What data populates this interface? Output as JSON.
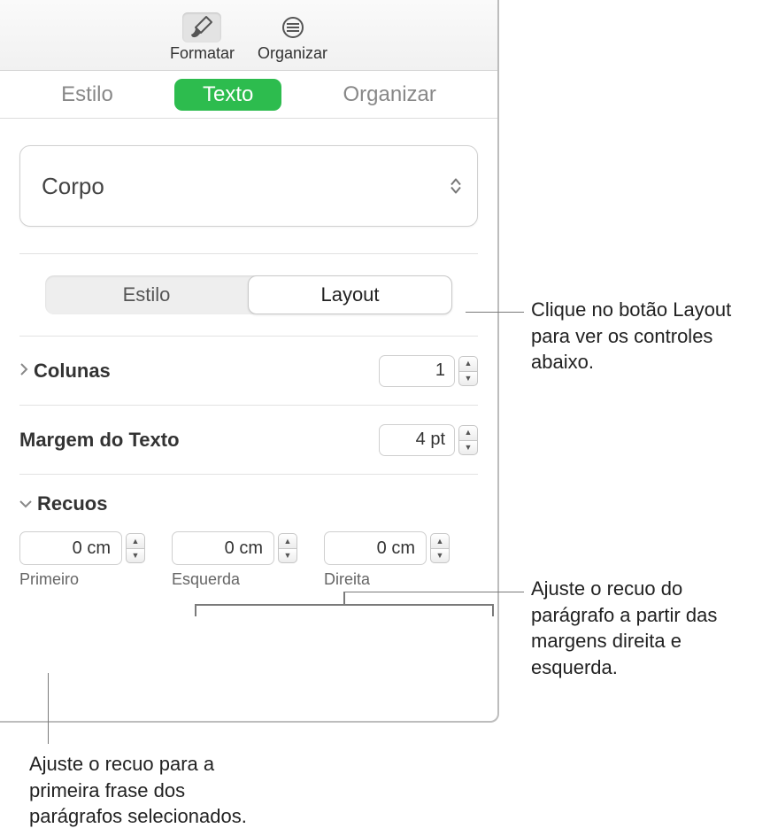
{
  "toolbar": {
    "format": "Formatar",
    "organize": "Organizar"
  },
  "subtabs": {
    "style": "Estilo",
    "text": "Texto",
    "organize": "Organizar"
  },
  "paragraphStyle": "Corpo",
  "segmented": {
    "style": "Estilo",
    "layout": "Layout"
  },
  "columns": {
    "label": "Colunas",
    "value": "1"
  },
  "textMargin": {
    "label": "Margem do Texto",
    "value": "4 pt"
  },
  "indents": {
    "label": "Recuos",
    "first": {
      "value": "0 cm",
      "label": "Primeiro"
    },
    "left": {
      "value": "0 cm",
      "label": "Esquerda"
    },
    "right": {
      "value": "0 cm",
      "label": "Direita"
    }
  },
  "callouts": {
    "layout": "Clique no botão Layout para ver os controles abaixo.",
    "lr": "Ajuste o recuo do parágrafo a partir das margens direita e esquerda.",
    "first": "Ajuste o recuo para a primeira frase dos parágrafos selecionados."
  }
}
